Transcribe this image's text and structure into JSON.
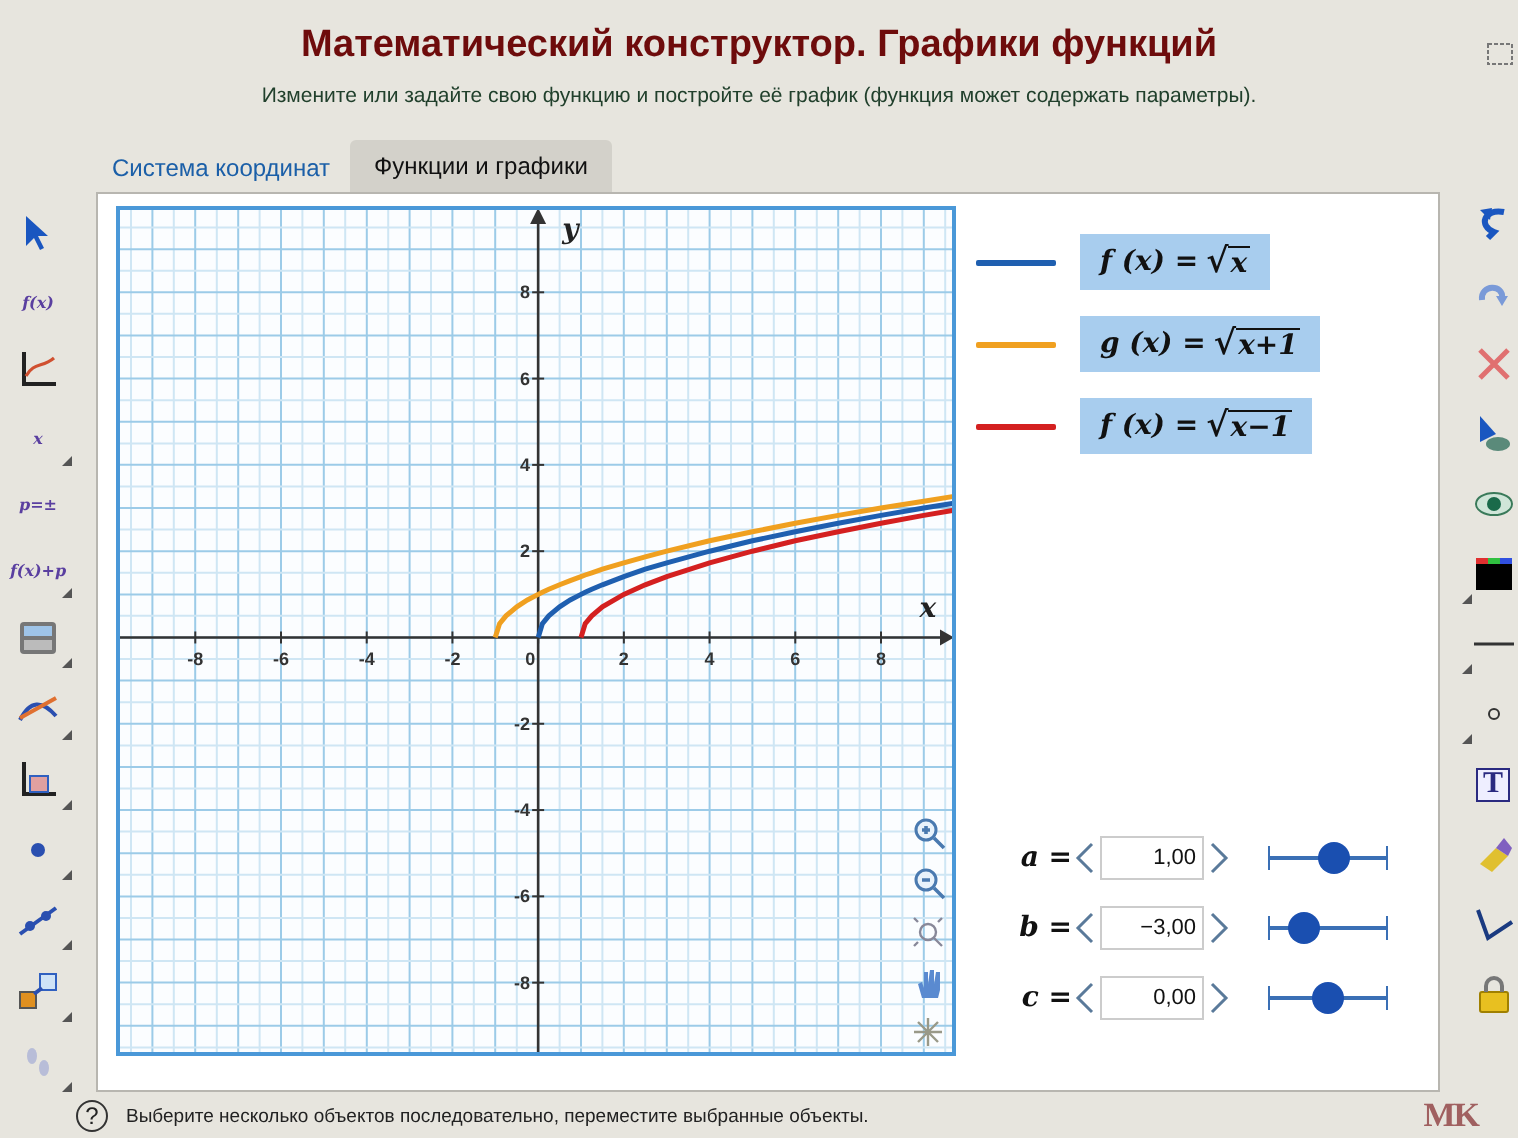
{
  "header": {
    "title": "Математический конструктор. Графики функций",
    "subtitle": "Измените или задайте свою функцию и постройте её график (функция может содержать параметры)."
  },
  "tabs": [
    {
      "label": "Система координат",
      "selected": false
    },
    {
      "label": "Функции и графики",
      "selected": true
    }
  ],
  "left_toolbar": [
    {
      "kind": "pointer",
      "has_menu": false
    },
    {
      "kind": "text",
      "label": "f(x)",
      "has_menu": false
    },
    {
      "kind": "axes",
      "has_menu": false
    },
    {
      "kind": "text",
      "label": "x",
      "has_menu": true
    },
    {
      "kind": "text",
      "label": "p=±",
      "has_menu": false
    },
    {
      "kind": "text",
      "label": "f(x)+p",
      "has_menu": true
    },
    {
      "kind": "calculator",
      "has_menu": true
    },
    {
      "kind": "tangent",
      "has_menu": true
    },
    {
      "kind": "area",
      "has_menu": true
    },
    {
      "kind": "point",
      "has_menu": true
    },
    {
      "kind": "segment",
      "has_menu": true
    },
    {
      "kind": "squares",
      "has_menu": true
    },
    {
      "kind": "footprints",
      "has_menu": true
    }
  ],
  "right_toolbar": [
    {
      "kind": "undo",
      "has_menu": false
    },
    {
      "kind": "redo",
      "has_menu": false
    },
    {
      "kind": "delete",
      "has_menu": false
    },
    {
      "kind": "pointer-eye",
      "has_menu": false
    },
    {
      "kind": "eye",
      "has_menu": false
    },
    {
      "kind": "palette",
      "has_menu": true
    },
    {
      "kind": "line",
      "has_menu": true
    },
    {
      "kind": "dot",
      "has_menu": true
    },
    {
      "kind": "text",
      "label": "T",
      "has_menu": false
    },
    {
      "kind": "eraser",
      "has_menu": false
    },
    {
      "kind": "measure",
      "has_menu": false
    },
    {
      "kind": "lock",
      "has_menu": false
    }
  ],
  "plot": {
    "chart_data": {
      "type": "line",
      "grid": true,
      "xlabel": "x",
      "ylabel": "y",
      "xlim": [
        -9.85,
        9.75
      ],
      "ylim": [
        -9.7,
        10
      ],
      "xticks": [
        -8,
        -6,
        -4,
        -2,
        0,
        2,
        4,
        6,
        8
      ],
      "yticks": [
        -8,
        -6,
        -4,
        -2,
        2,
        4,
        6,
        8
      ],
      "x": [
        -1,
        -0.9,
        -0.75,
        -0.5,
        -0.25,
        0,
        0.1,
        0.25,
        0.5,
        0.75,
        1,
        1.1,
        1.25,
        1.5,
        2,
        2.5,
        3,
        4,
        5,
        6,
        7,
        8,
        9,
        9.7
      ],
      "series": [
        {
          "color": "#1f5fb0",
          "values": [
            null,
            null,
            null,
            null,
            null,
            0,
            0.32,
            0.5,
            0.71,
            0.87,
            1,
            1.05,
            1.12,
            1.22,
            1.41,
            1.58,
            1.73,
            2,
            2.24,
            2.45,
            2.65,
            2.83,
            3,
            3.11
          ]
        },
        {
          "color": "#f0a020",
          "values": [
            0,
            0.32,
            0.5,
            0.71,
            0.87,
            1,
            1.05,
            1.12,
            1.22,
            1.32,
            1.41,
            1.45,
            1.5,
            1.58,
            1.73,
            1.87,
            2,
            2.24,
            2.45,
            2.65,
            2.83,
            3,
            3.16,
            3.27
          ]
        },
        {
          "color": "#d42020",
          "values": [
            null,
            null,
            null,
            null,
            null,
            null,
            null,
            null,
            null,
            null,
            0,
            0.32,
            0.5,
            0.71,
            1,
            1.22,
            1.41,
            1.73,
            2,
            2.24,
            2.45,
            2.65,
            2.83,
            2.95
          ]
        }
      ]
    }
  },
  "legend": [
    {
      "color": "#1f5fb0",
      "lhs": "f (x) = ",
      "radical": "√",
      "radicand": "x"
    },
    {
      "color": "#f0a020",
      "lhs": "g (x) = ",
      "radical": "√",
      "radicand": "x+1"
    },
    {
      "color": "#d42020",
      "lhs": "f (x) = ",
      "radical": "√",
      "radicand": "x−1"
    }
  ],
  "parameters": [
    {
      "label": "a =",
      "value": "1,00",
      "level": 0.55
    },
    {
      "label": "b =",
      "value": "−3,00",
      "level": 0.3
    },
    {
      "label": "c =",
      "value": "0,00",
      "level": 0.5
    }
  ],
  "status_bar": {
    "help": "?",
    "message": "Выберите несколько объектов последовательно, переместите выбранные объекты.",
    "logo": "MK"
  }
}
